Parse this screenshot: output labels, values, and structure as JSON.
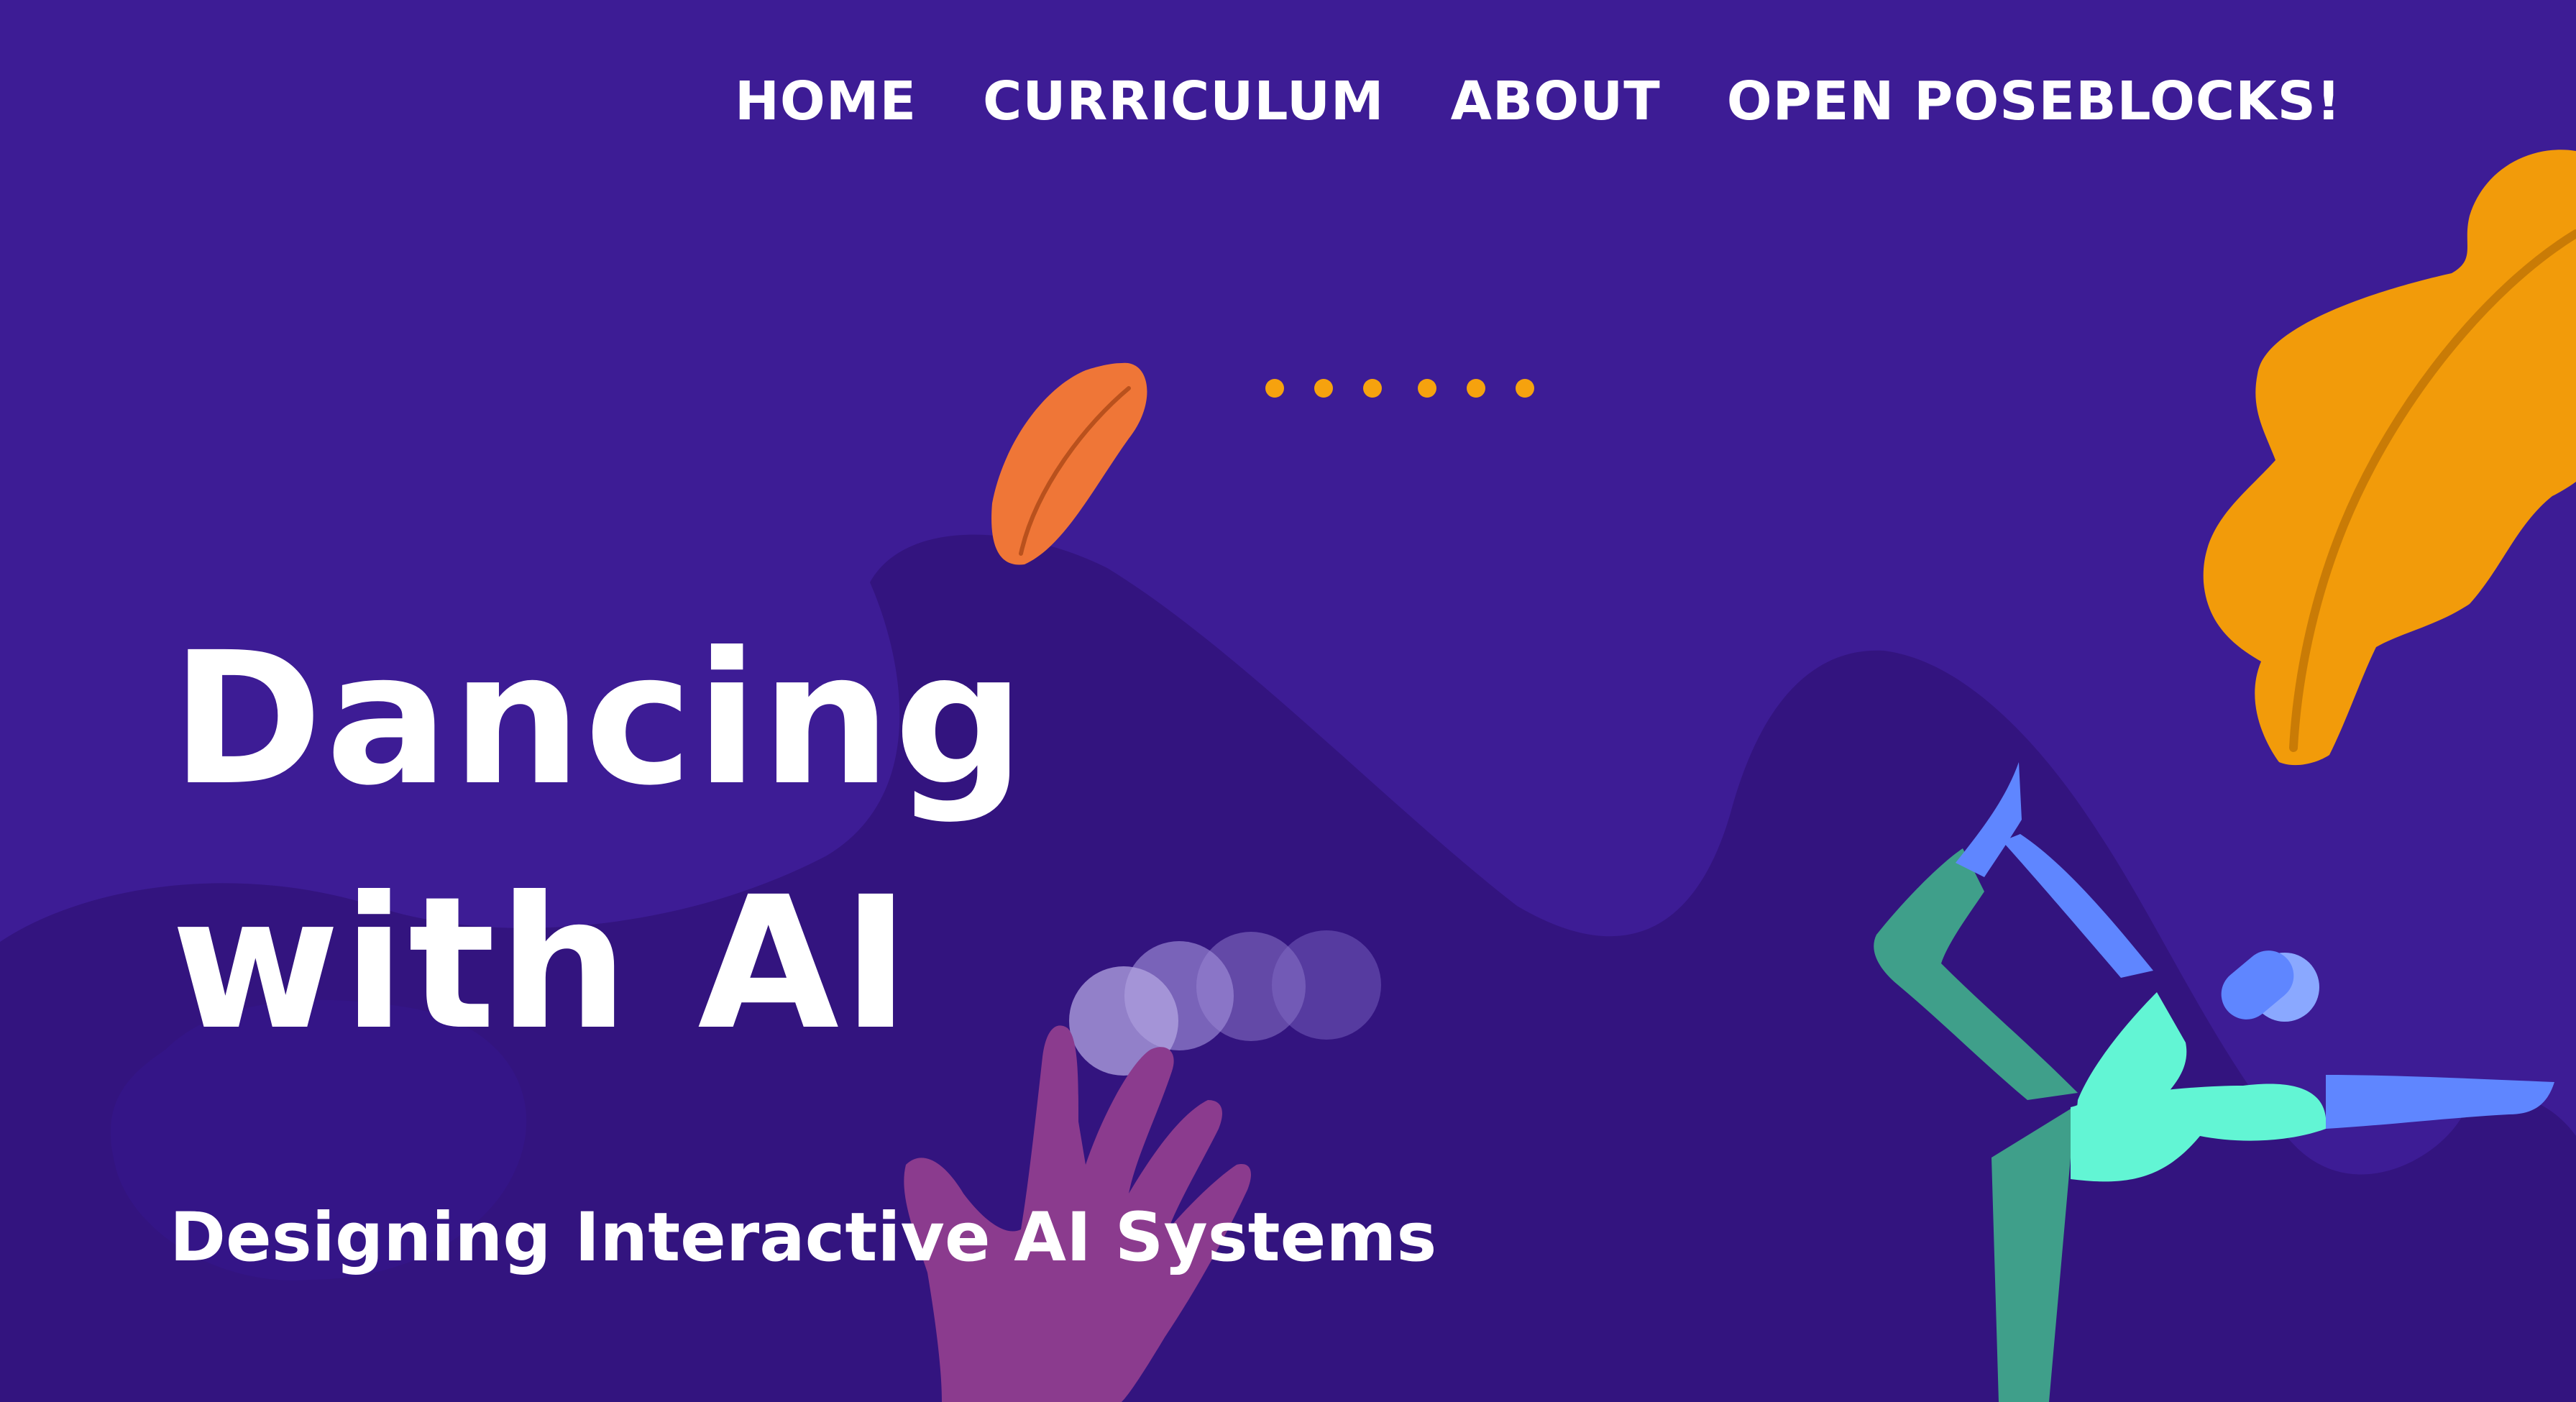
{
  "nav": {
    "items": [
      {
        "label": "HOME"
      },
      {
        "label": "CURRICULUM"
      },
      {
        "label": "ABOUT"
      },
      {
        "label": "OPEN POSEBLOCKS!"
      }
    ]
  },
  "hero": {
    "title_line_1": "Dancing",
    "title_line_2": "with AI",
    "subtitle": "Designing Interactive AI Systems"
  },
  "colors": {
    "background": "#3d1c95",
    "background_blob": "#33147f",
    "leaf_orange_large": "#f29b0a",
    "leaf_orange_small": "#ef7637",
    "dot_accent": "#f6a20e",
    "hand": "#8b3b8e",
    "dancer_green": "#3f9f8a",
    "dancer_mint": "#62f5d4",
    "dancer_blue": "#5f86ff",
    "text": "#ffffff"
  },
  "icons": {
    "leaf_large": "leaf-icon",
    "leaf_small": "leaf-icon",
    "dots": "loading-dots-icon",
    "hand": "hand-icon",
    "dancer": "dancer-figure-icon"
  }
}
